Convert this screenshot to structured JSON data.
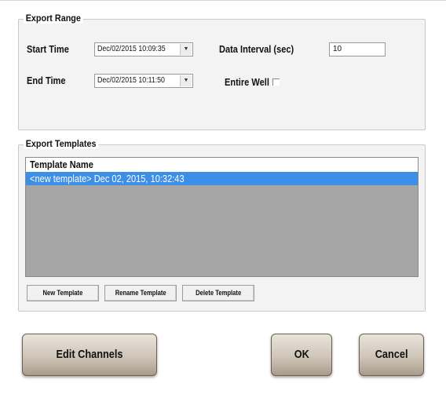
{
  "export_range": {
    "title": "Export Range",
    "start_time_label": "Start Time",
    "start_time_value": "Dec/02/2015 10:09:35",
    "end_time_label": "End Time",
    "end_time_value": "Dec/02/2015 10:11:50",
    "data_interval_label": "Data Interval (sec)",
    "data_interval_value": "10",
    "entire_well_label": "Entire Well",
    "entire_well_checked": false
  },
  "export_templates": {
    "title": "Export Templates",
    "column_header": "Template Name",
    "rows": [
      "<new template> Dec 02, 2015, 10:32:43"
    ],
    "new_label": "New Template",
    "rename_label": "Rename Template",
    "delete_label": "Delete Template"
  },
  "footer": {
    "edit_channels_label": "Edit Channels",
    "ok_label": "OK",
    "cancel_label": "Cancel"
  }
}
